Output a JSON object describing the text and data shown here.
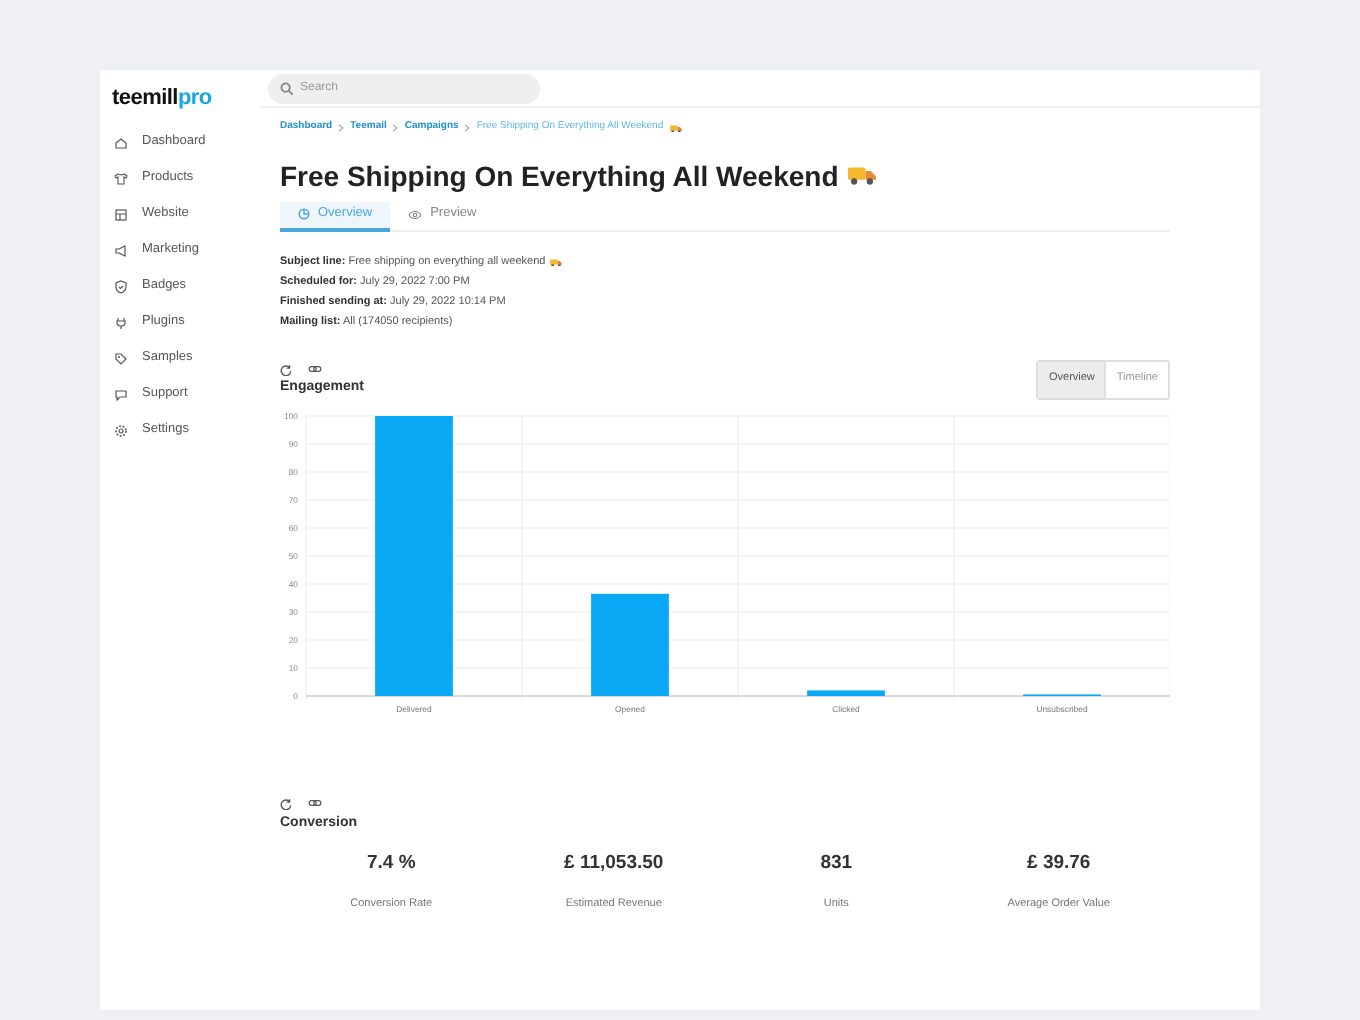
{
  "logo": {
    "part_1": "teemill",
    "part_2": "pro"
  },
  "search": {
    "placeholder": "Search"
  },
  "sidebar": {
    "items": [
      {
        "label": "Dashboard"
      },
      {
        "label": "Products"
      },
      {
        "label": "Website"
      },
      {
        "label": "Marketing"
      },
      {
        "label": "Badges"
      },
      {
        "label": "Plugins"
      },
      {
        "label": "Samples"
      },
      {
        "label": "Support"
      },
      {
        "label": "Settings"
      }
    ]
  },
  "breadcrumb": [
    "Dashboard",
    "Teemail",
    "Campaigns",
    "Free Shipping On Everything All Weekend"
  ],
  "title": "Free Shipping On Everything All Weekend",
  "tabs": [
    {
      "label": "Overview",
      "selected": true
    },
    {
      "label": "Preview",
      "selected": false
    }
  ],
  "details": [
    {
      "label": "Subject line:",
      "value": "Free shipping on everything all weekend"
    },
    {
      "label": "Scheduled for:",
      "value": "July 29, 2022 7:00 PM"
    },
    {
      "label": "Finished sending at:",
      "value": "July 29, 2022 10:14 PM"
    },
    {
      "label": "Mailing list:",
      "value": "All (174050 recipients)"
    }
  ],
  "engagement": {
    "title": "Engagement",
    "views": [
      {
        "label": "Overview",
        "selected": true
      },
      {
        "label": "Timeline",
        "selected": false
      }
    ],
    "chart_data": {
      "type": "bar",
      "categories": [
        "Delivered",
        "Opened",
        "Clicked",
        "Unsubscribed"
      ],
      "values": [
        100,
        36.5,
        2,
        0.3
      ],
      "grid": true,
      "ylim": [
        0,
        100
      ],
      "yticks": [
        0,
        10,
        20,
        30,
        40,
        50,
        60,
        70,
        80,
        90,
        100
      ]
    }
  },
  "conversion": {
    "title": "Conversion",
    "metrics": [
      {
        "value": "7.4 %",
        "label": "Conversion Rate"
      },
      {
        "value": "£ 11,053.50",
        "label": "Estimated Revenue"
      },
      {
        "value": "831",
        "label": "Units"
      },
      {
        "value": "£ 39.76",
        "label": "Average Order Value"
      }
    ]
  }
}
